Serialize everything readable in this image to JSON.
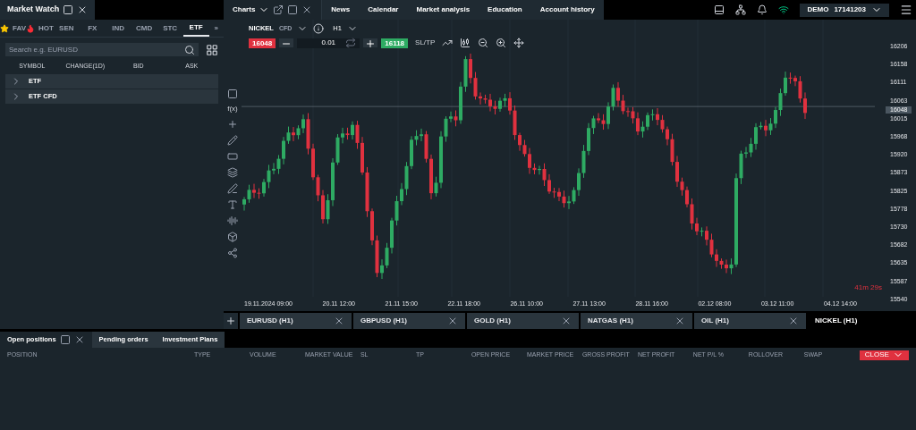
{
  "market_watch": {
    "title": "Market Watch",
    "categories": [
      {
        "label": "FAV",
        "selected": false
      },
      {
        "label": "HOT",
        "selected": false
      },
      {
        "label": "SEN",
        "selected": false
      },
      {
        "label": "FX",
        "selected": false
      },
      {
        "label": "IND",
        "selected": false
      },
      {
        "label": "CMD",
        "selected": false
      },
      {
        "label": "STC",
        "selected": false
      },
      {
        "label": "ETF",
        "selected": true
      }
    ],
    "more": "»",
    "search": {
      "placeholder": "Search e.g. EURUSD"
    },
    "columns": [
      "SYMBOL",
      "CHANGE(1D)",
      "BID",
      "ASK"
    ],
    "groups": [
      {
        "name": "ETF",
        "expanded": false
      },
      {
        "name": "ETF CFD",
        "expanded": false
      }
    ]
  },
  "top_tabs": [
    {
      "label": "Charts",
      "selected": true
    },
    {
      "label": "News",
      "selected": false
    },
    {
      "label": "Calendar",
      "selected": false
    },
    {
      "label": "Market analysis",
      "selected": false
    },
    {
      "label": "Education",
      "selected": false
    },
    {
      "label": "Account history",
      "selected": false
    }
  ],
  "account": {
    "mode": "DEMO",
    "number": "17141203"
  },
  "chart": {
    "symbol": "NICKEL",
    "symbol_tag": "CFD",
    "timeframe": "H1",
    "sell_price": "16048",
    "volume": "0.01",
    "buy_price": "16118",
    "sltp": "SL/TP",
    "fx_label": "f(x)",
    "current_price": "16048",
    "timer": "41m 29s",
    "price_labels": [
      "16206",
      "16158",
      "16111",
      "16063",
      "16015",
      "15968",
      "15920",
      "15873",
      "15825",
      "15778",
      "15730",
      "15682",
      "15635",
      "15587",
      "15540"
    ],
    "time_labels": [
      "19.11.2024 09:00",
      "20.11 12:00",
      "21.11 15:00",
      "22.11 18:00",
      "26.11 10:00",
      "27.11 13:00",
      "28.11 16:00",
      "02.12 08:00",
      "03.12 11:00",
      "04.12 14:00"
    ]
  },
  "symbol_tabs": [
    {
      "label": "EURUSD (H1)",
      "selected": false
    },
    {
      "label": "GBPUSD (H1)",
      "selected": false
    },
    {
      "label": "GOLD (H1)",
      "selected": false
    },
    {
      "label": "NATGAS (H1)",
      "selected": false
    },
    {
      "label": "OIL (H1)",
      "selected": false
    },
    {
      "label": "NICKEL (H1)",
      "selected": true
    }
  ],
  "bottom_tabs": [
    {
      "label": "Open positions",
      "selected": true
    },
    {
      "label": "Pending orders",
      "selected": false
    },
    {
      "label": "Investment Plans",
      "selected": false
    }
  ],
  "positions_columns": [
    "POSITION",
    "TYPE",
    "VOLUME",
    "MARKET VALUE",
    "SL",
    "TP",
    "OPEN PRICE",
    "MARKET PRICE",
    "GROSS PROFIT",
    "NET PROFIT",
    "NET P/L %",
    "ROLLOVER",
    "SWAP"
  ],
  "close_button": "CLOSE"
}
